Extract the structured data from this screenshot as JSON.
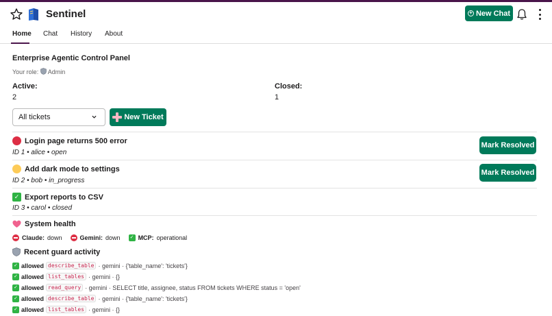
{
  "app": {
    "title": "Sentinel",
    "new_chat_label": "New Chat"
  },
  "tabs": [
    {
      "label": "Home",
      "active": true
    },
    {
      "label": "Chat",
      "active": false
    },
    {
      "label": "History",
      "active": false
    },
    {
      "label": "About",
      "active": false
    }
  ],
  "panel": {
    "title": "Enterprise Agentic Control Panel",
    "role_label": "Your role:",
    "role_value": "Admin",
    "active_label": "Active:",
    "active_value": "2",
    "closed_label": "Closed:",
    "closed_value": "1"
  },
  "filter": {
    "selected": "All tickets"
  },
  "new_ticket_label": "New Ticket",
  "tickets": [
    {
      "status_icon": "red-circle-icon",
      "title": "Login page returns 500 error",
      "meta": "ID 1 • alice • open",
      "action": "Mark Resolved"
    },
    {
      "status_icon": "yellow-circle-icon",
      "title": "Add dark mode to settings",
      "meta": "ID 2 • bob • in_progress",
      "action": "Mark Resolved"
    },
    {
      "status_icon": "check-icon",
      "title": "Export reports to CSV",
      "meta": "ID 3 • carol • closed",
      "action": ""
    }
  ],
  "health": {
    "title": "System health",
    "items": [
      {
        "name": "Claude:",
        "status": "down",
        "icon": "no-entry-icon"
      },
      {
        "name": "Gemini:",
        "status": "down",
        "icon": "no-entry-icon"
      },
      {
        "name": "MCP:",
        "status": "operational",
        "icon": "check-icon"
      }
    ]
  },
  "guard": {
    "title": "Recent guard activity",
    "rows": [
      {
        "status": "allowed",
        "tool": "describe_table",
        "rest": "· gemini · {'table_name': 'tickets'}"
      },
      {
        "status": "allowed",
        "tool": "list_tables",
        "rest": "· gemini · {}"
      },
      {
        "status": "allowed",
        "tool": "read_query",
        "rest": "· gemini · SELECT title, assignee, status FROM tickets WHERE status = 'open'"
      },
      {
        "status": "allowed",
        "tool": "describe_table",
        "rest": "· gemini · {'table_name': 'tickets'}"
      },
      {
        "status": "allowed",
        "tool": "list_tables",
        "rest": "· gemini · {}"
      }
    ]
  },
  "colors": {
    "brand": "#4a154b",
    "button": "#007a5a",
    "code": "#c7254e"
  }
}
